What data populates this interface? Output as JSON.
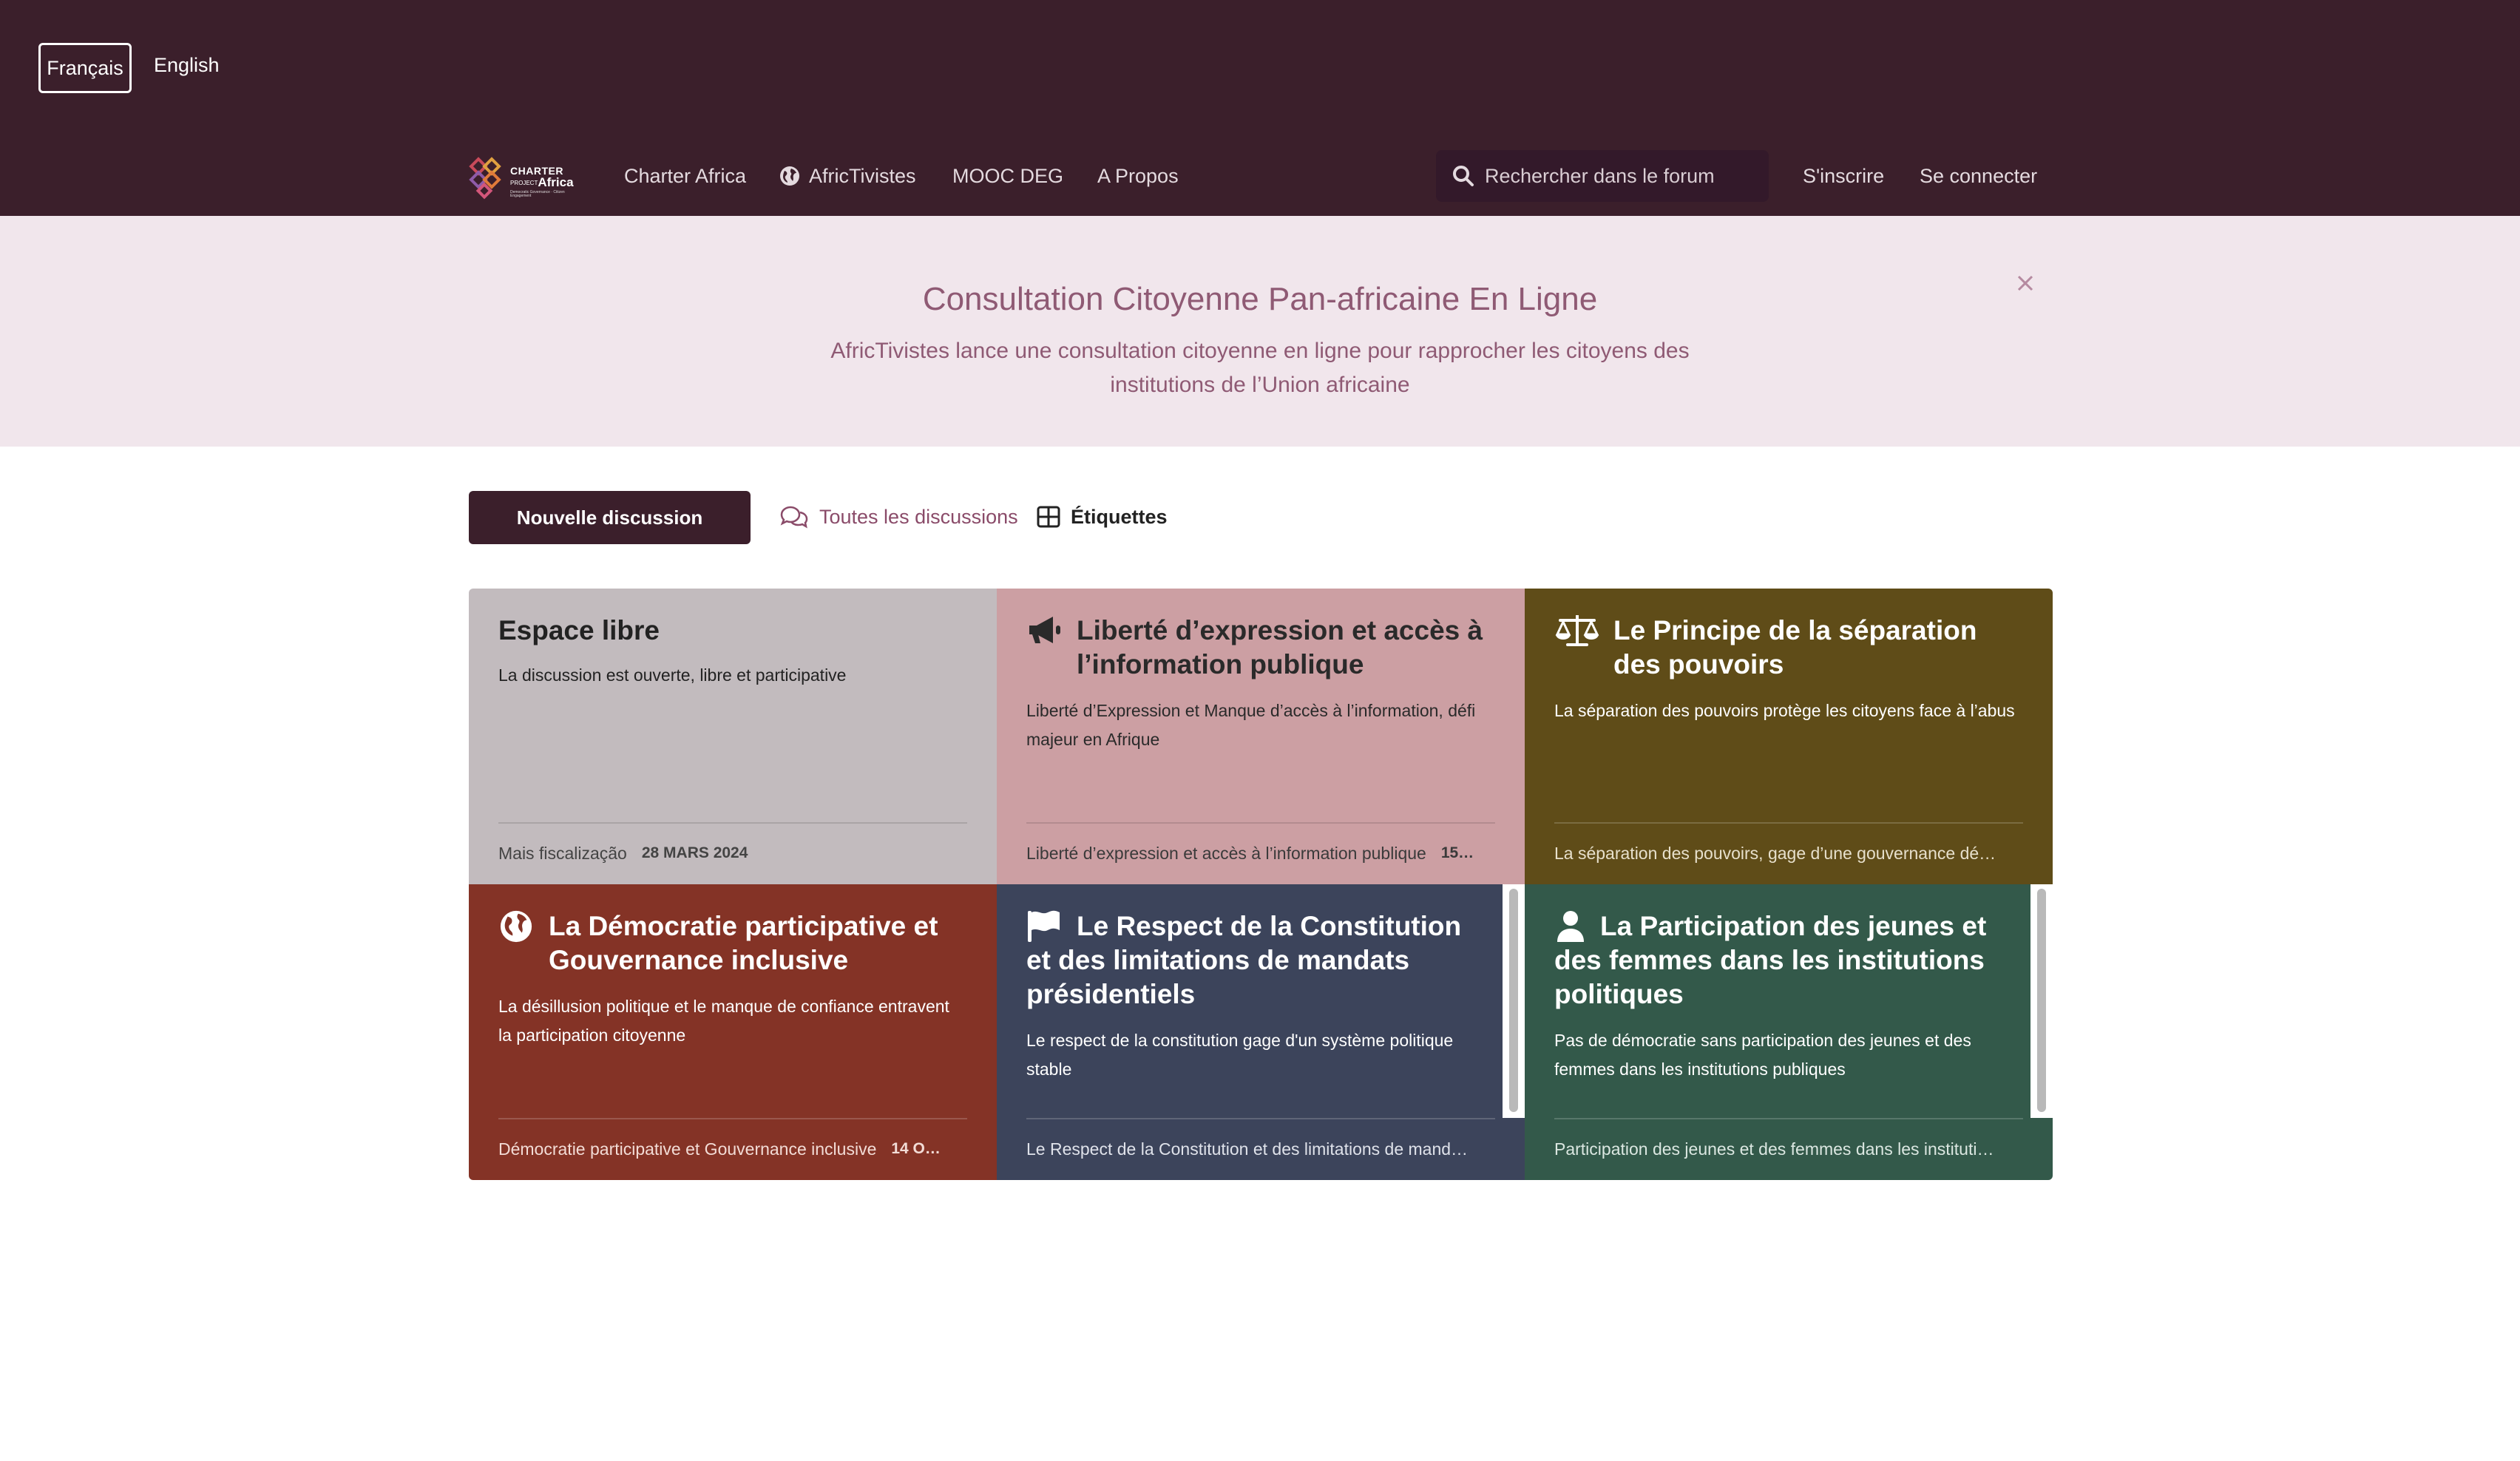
{
  "languages": {
    "french": "Français",
    "english": "English"
  },
  "logo": {
    "line1": "CHARTER",
    "line2": "PROJECT",
    "line3": "Africa",
    "line4": "Democratic Governance · Citizen Engagement"
  },
  "nav": {
    "charter_africa": "Charter Africa",
    "africtivistes": "AfricTivistes",
    "mooc": "MOOC DEG",
    "about": "A Propos",
    "search_placeholder": "Rechercher dans le forum",
    "signup": "S'inscrire",
    "login": "Se connecter"
  },
  "hero": {
    "title": "Consultation Citoyenne Pan-africaine En Ligne",
    "subtitle": "AfricTivistes lance une consultation citoyenne en ligne pour rapprocher les citoyens des institutions de l’Union africaine"
  },
  "toolbar": {
    "new_discussion": "Nouvelle discussion",
    "all_discussions": "Toutes les discussions",
    "tags": "Étiquettes"
  },
  "tags": [
    {
      "title": "Espace libre",
      "icon": "none",
      "description": "La discussion est ouverte, libre et participative",
      "last_discussion": "Mais fiscalização",
      "last_date": "28 MARS 2024",
      "bg": "#c2bbbe",
      "text_color": "#222222"
    },
    {
      "title": "Liberté d’expression et accès à l’information publique",
      "icon": "bullhorn-icon",
      "description": "Liberté d’Expression et Manque d’accès à l’information, défi majeur en Afrique",
      "last_discussion": "Liberté d’expression et accès à l’information publique",
      "last_date": "15…",
      "bg": "#cc9fa3",
      "text_color": "#2a2a2a"
    },
    {
      "title": "Le Principe de la séparation des pouvoirs",
      "icon": "balance-scale-icon",
      "description": "La séparation des pouvoirs protège les citoyens face à l’abus",
      "last_discussion": "La séparation des pouvoirs, gage d’une gouvernance dé…",
      "last_date": "",
      "bg": "#5f4c18",
      "text_color": "#ffffff"
    },
    {
      "title": "La Démocratie participative et Gouvernance inclusive",
      "icon": "globe-africa-icon",
      "description": "La désillusion politique et le manque de confiance entravent la participation citoyenne",
      "last_discussion": "Démocratie participative et Gouvernance inclusive",
      "last_date": "14 O…",
      "bg": "#843326",
      "text_color": "#ffffff"
    },
    {
      "title": "Le Respect de la Constitution et des limitations de mandats présidentiels",
      "icon": "flag-icon",
      "description": "Le respect de la constitution gage d'un système politique stable",
      "last_discussion": "Le Respect de la Constitution et des limitations de mand…",
      "last_date": "",
      "bg": "#3c445b",
      "text_color": "#ffffff"
    },
    {
      "title": "La Participation des jeunes et des femmes dans les institutions politiques",
      "icon": "user-icon",
      "description": "Pas de démocratie sans participation des jeunes et des femmes dans les institutions publiques",
      "last_discussion": "Participation des jeunes et des femmes dans les instituti…",
      "last_date": "",
      "bg": "#33594a",
      "text_color": "#ffffff"
    }
  ]
}
